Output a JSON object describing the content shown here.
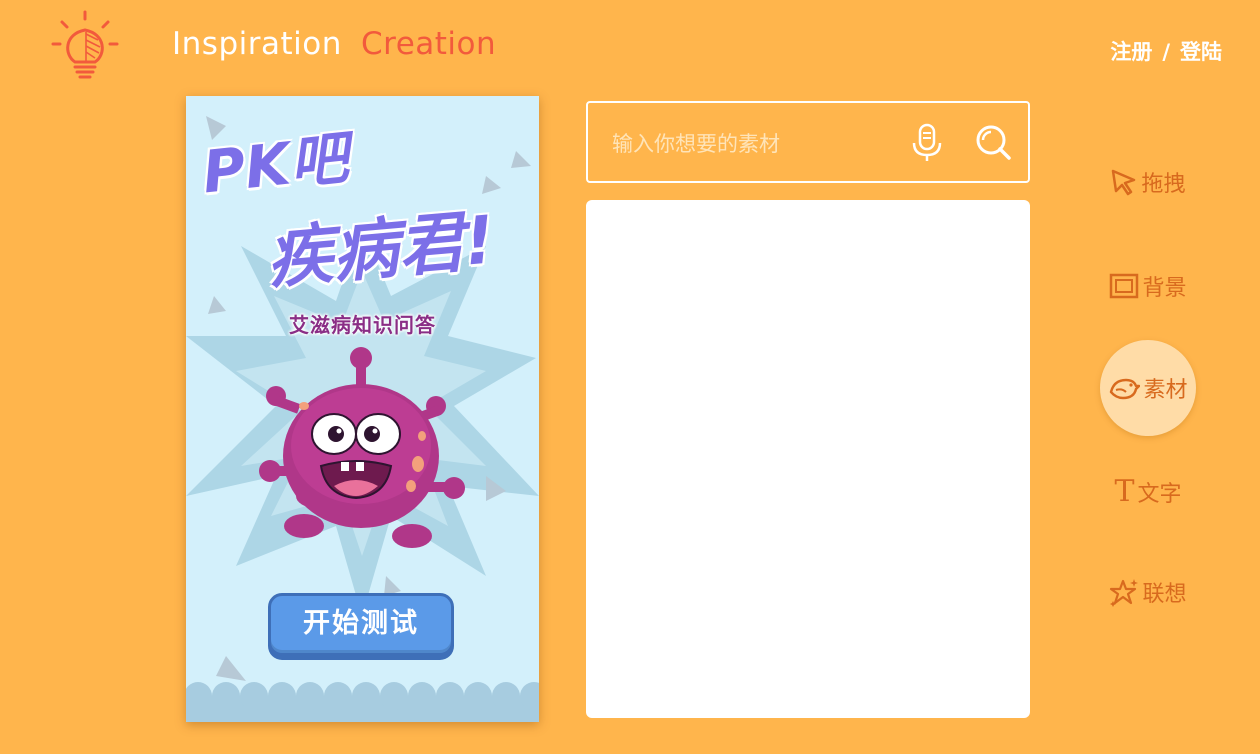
{
  "header": {
    "nav": {
      "inspiration": "Inspiration",
      "creation": "Creation"
    },
    "auth": {
      "register": "注册",
      "separator": "/",
      "login": "登陆"
    },
    "colors": {
      "background": "#FFB54C",
      "active_nav": "#F25A3C",
      "logo": "#F25A3C"
    }
  },
  "poster": {
    "title_line1": "PK吧",
    "title_line2": "疾病君!",
    "subtitle": "艾滋病知识问答",
    "start_button": "开始测试"
  },
  "search": {
    "placeholder": "输入你想要的素材",
    "icons": [
      "microphone-icon",
      "search-icon"
    ]
  },
  "tools": [
    {
      "label": "拖拽",
      "icon": "cursor-icon",
      "active": false
    },
    {
      "label": "背景",
      "icon": "frame-icon",
      "active": false
    },
    {
      "label": "素材",
      "icon": "bird-icon",
      "active": true
    },
    {
      "label": "文字",
      "icon": "text-icon",
      "active": false
    },
    {
      "label": "联想",
      "icon": "sparkle-icon",
      "active": false
    }
  ]
}
